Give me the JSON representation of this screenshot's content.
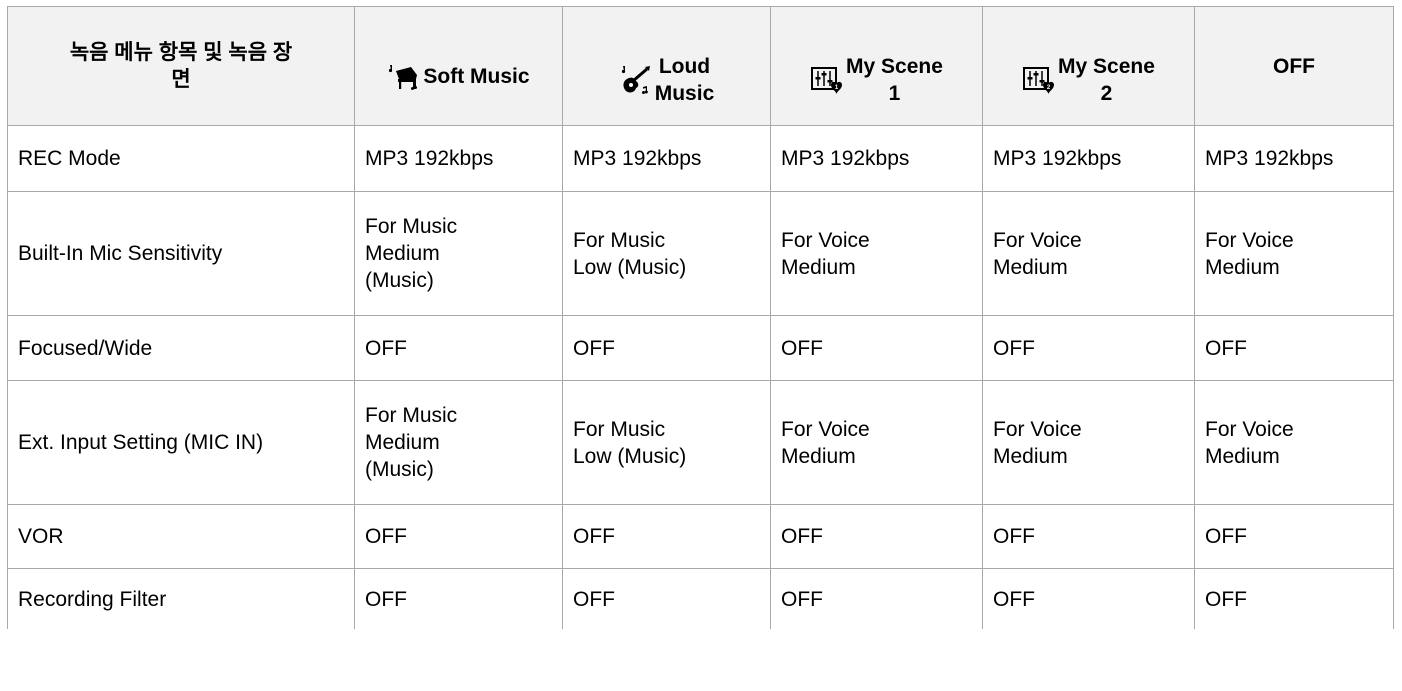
{
  "table": {
    "header": {
      "item_col": "녹음 메뉴 항목 및 녹음 장\n면",
      "scenes": [
        {
          "label": "Soft Music",
          "icon": "soft-music-icon"
        },
        {
          "label": "Loud\nMusic",
          "icon": "loud-music-icon"
        },
        {
          "label": "My Scene\n1",
          "icon": "my-scene-1-icon"
        },
        {
          "label": "My Scene\n2",
          "icon": "my-scene-2-icon"
        },
        {
          "label": "OFF",
          "icon": ""
        }
      ]
    },
    "rows": [
      {
        "item": "REC Mode",
        "values": [
          "MP3 192kbps",
          "MP3 192kbps",
          "MP3 192kbps",
          "MP3 192kbps",
          "MP3 192kbps"
        ]
      },
      {
        "item": "Built-In Mic Sensitivity",
        "values": [
          "For Music\nMedium\n(Music)",
          "For Music\nLow (Music)",
          "For Voice\nMedium",
          "For Voice\nMedium",
          "For Voice\nMedium"
        ]
      },
      {
        "item": "Focused/Wide",
        "values": [
          "OFF",
          "OFF",
          "OFF",
          "OFF",
          "OFF"
        ]
      },
      {
        "item": "Ext. Input Setting (MIC IN)",
        "values": [
          "For Music\nMedium\n(Music)",
          "For Music\nLow (Music)",
          "For Voice\nMedium",
          "For Voice\nMedium",
          "For Voice\nMedium"
        ]
      },
      {
        "item": "VOR",
        "values": [
          "OFF",
          "OFF",
          "OFF",
          "OFF",
          "OFF"
        ]
      },
      {
        "item": "Recording Filter",
        "values": [
          "OFF",
          "OFF",
          "OFF",
          "OFF",
          "OFF"
        ]
      }
    ]
  },
  "colors": {
    "header_bg": "#f2f2f2",
    "border": "#a9a9a9",
    "text": "#000000"
  }
}
